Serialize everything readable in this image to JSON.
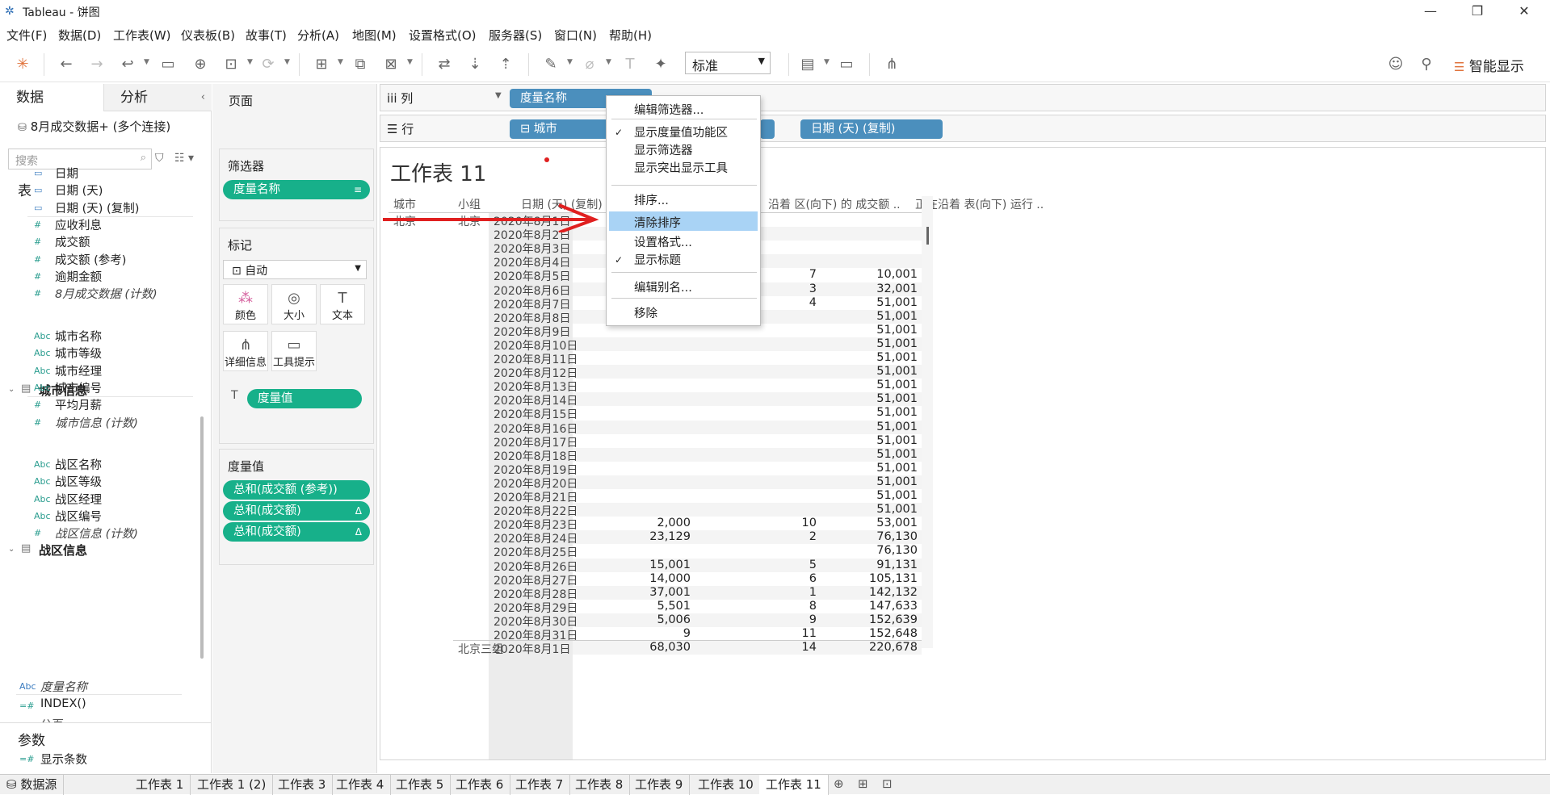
{
  "window": {
    "title": "Tableau - 饼图"
  },
  "menu": [
    "文件(F)",
    "数据(D)",
    "工作表(W)",
    "仪表板(B)",
    "故事(T)",
    "分析(A)",
    "地图(M)",
    "设置格式(O)",
    "服务器(S)",
    "窗口(N)",
    "帮助(H)"
  ],
  "toolbar": {
    "view_size": "标准",
    "show_me": "智能显示"
  },
  "left": {
    "tab_data": "数据",
    "tab_analysis": "分析",
    "datasource": "8月成交数据+ (多个连接)",
    "search_placeholder": "搜索",
    "tables_title": "表",
    "fields_main": [
      {
        "icon": "▭",
        "label": "日期"
      },
      {
        "icon": "▭",
        "label": "日期 (天)"
      },
      {
        "icon": "▭",
        "label": "日期 (天) (复制)"
      },
      {
        "icon": "#",
        "label": "应收利息"
      },
      {
        "icon": "#",
        "label": "成交额"
      },
      {
        "icon": "#",
        "label": "成交额 (参考)"
      },
      {
        "icon": "#",
        "label": "逾期金额"
      },
      {
        "icon": "#",
        "label": "8月成交数据 (计数)"
      }
    ],
    "group_city": "城市信息",
    "fields_city": [
      {
        "icon": "Abc",
        "label": "城市名称"
      },
      {
        "icon": "Abc",
        "label": "城市等级"
      },
      {
        "icon": "Abc",
        "label": "城市经理"
      },
      {
        "icon": "Abc",
        "label": "城市编号"
      },
      {
        "icon": "#",
        "label": "平均月薪"
      },
      {
        "icon": "#",
        "label": "城市信息 (计数)"
      }
    ],
    "group_zone": "战区信息",
    "fields_zone": [
      {
        "icon": "Abc",
        "label": "战区名称"
      },
      {
        "icon": "Abc",
        "label": "战区等级"
      },
      {
        "icon": "Abc",
        "label": "战区经理"
      },
      {
        "icon": "Abc",
        "label": "战区编号"
      },
      {
        "icon": "#",
        "label": "战区信息 (计数)"
      }
    ],
    "measure_names": "度量名称",
    "index_field": "INDEX()",
    "cut_field": "公页",
    "params_title": "参数",
    "param_item": "显示条数"
  },
  "shelves": {
    "pages": "页面",
    "filters": "筛选器",
    "filter_pill": "度量名称",
    "marks": "标记",
    "mark_type": "自动",
    "mark_buttons": [
      "颜色",
      "大小",
      "文本",
      "详细信息",
      "工具提示"
    ],
    "mark_pill": "度量值",
    "measure_values": "度量值",
    "mv_pills": [
      "总和(成交额 (参考))",
      "总和(成交额)",
      "总和(成交额)"
    ],
    "delta": "Δ"
  },
  "columns": {
    "label": "列",
    "pill": "度量名称"
  },
  "rows": {
    "label": "行",
    "pill1": "城市",
    "pill2": "日期 (天) (复制)"
  },
  "sheet": {
    "title": "工作表 11",
    "headers": [
      "城市",
      "小组",
      "日期 (天) (复制)",
      "沿着 区(向下) 的 成交额 ..",
      "正在沿着 表(向下) 运行 .."
    ],
    "city": "北京",
    "group1": "北京一组",
    "group2": "北京三组",
    "dates": [
      "2020年8月1日",
      "2020年8月2日",
      "2020年8月3日",
      "2020年8月4日",
      "2020年8月5日",
      "2020年8月6日",
      "2020年8月7日",
      "2020年8月8日",
      "2020年8月9日",
      "2020年8月10日",
      "2020年8月11日",
      "2020年8月12日",
      "2020年8月13日",
      "2020年8月14日",
      "2020年8月15日",
      "2020年8月16日",
      "2020年8月17日",
      "2020年8月18日",
      "2020年8月19日",
      "2020年8月20日",
      "2020年8月21日",
      "2020年8月22日",
      "2020年8月23日",
      "2020年8月24日",
      "2020年8月25日",
      "2020年8月26日",
      "2020年8月27日",
      "2020年8月28日",
      "2020年8月29日",
      "2020年8月30日",
      "2020年8月31日",
      "2020年8月1日"
    ],
    "col1": [
      "",
      "",
      "",
      "",
      "",
      "",
      "",
      "",
      "",
      "",
      "",
      "",
      "",
      "",
      "",
      "",
      "",
      "",
      "",
      "",
      "",
      "",
      "2,000",
      "23,129",
      "",
      "15,001",
      "14,000",
      "37,001",
      "5,501",
      "5,006",
      "9",
      "68,030"
    ],
    "col2": [
      "",
      "",
      "",
      "",
      "7",
      "3",
      "4",
      "",
      "",
      "",
      "",
      "",
      "",
      "",
      "",
      "",
      "",
      "",
      "",
      "",
      "",
      "",
      "10",
      "2",
      "",
      "5",
      "6",
      "1",
      "8",
      "9",
      "11",
      "14"
    ],
    "col3": [
      "",
      "",
      "",
      "",
      "10,001",
      "32,001",
      "51,001",
      "51,001",
      "51,001",
      "51,001",
      "51,001",
      "51,001",
      "51,001",
      "51,001",
      "51,001",
      "51,001",
      "51,001",
      "51,001",
      "51,001",
      "51,001",
      "51,001",
      "51,001",
      "53,001",
      "76,130",
      "76,130",
      "91,131",
      "105,131",
      "142,132",
      "147,633",
      "152,639",
      "152,648",
      "220,678"
    ]
  },
  "context_menu": {
    "items": [
      "编辑筛选器...",
      "显示度量值功能区",
      "显示筛选器",
      "显示突出显示工具",
      "排序...",
      "清除排序",
      "设置格式...",
      "显示标题",
      "编辑别名...",
      "移除"
    ]
  },
  "bottom_tabs": [
    "数据源",
    "工作表 1",
    "工作表 1 (2)",
    "工作表 3",
    "工作表 4",
    "工作表 5",
    "工作表 6",
    "工作表 7",
    "工作表 8",
    "工作表 9",
    "工作表 10",
    "工作表 11"
  ],
  "colors": {
    "green_pill": "#17b08a",
    "blue_pill": "#4b8fbd",
    "highlight": "#a9d3f5",
    "arrow": "#e02020"
  }
}
